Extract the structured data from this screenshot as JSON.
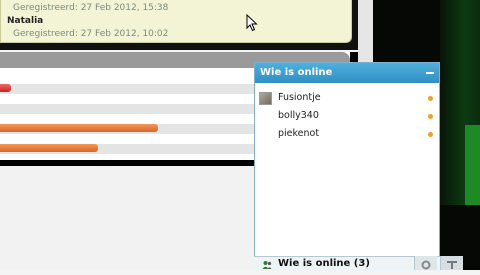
{
  "notifications": {
    "prev_registered": "Geregistreerd: 27 Feb 2012, 15:38",
    "user_name": "Natalia",
    "user_registered": "Geregistreerd: 27 Feb 2012, 10:02"
  },
  "chart_bars": [
    {
      "color": "red",
      "fill": 0.03
    },
    {
      "color": "orange",
      "fill": 0.45
    },
    {
      "color": "orange",
      "fill": 0.28
    }
  ],
  "online_widget": {
    "title": "Wie is online",
    "users": [
      {
        "name": "Fusiontje",
        "has_avatar": true
      },
      {
        "name": "bolly340",
        "has_avatar": false
      },
      {
        "name": "piekenot",
        "has_avatar": false
      }
    ],
    "footer_label": "Wie is online (3)",
    "status_color": "#f0a020",
    "header_color": "#3a9fd0"
  }
}
